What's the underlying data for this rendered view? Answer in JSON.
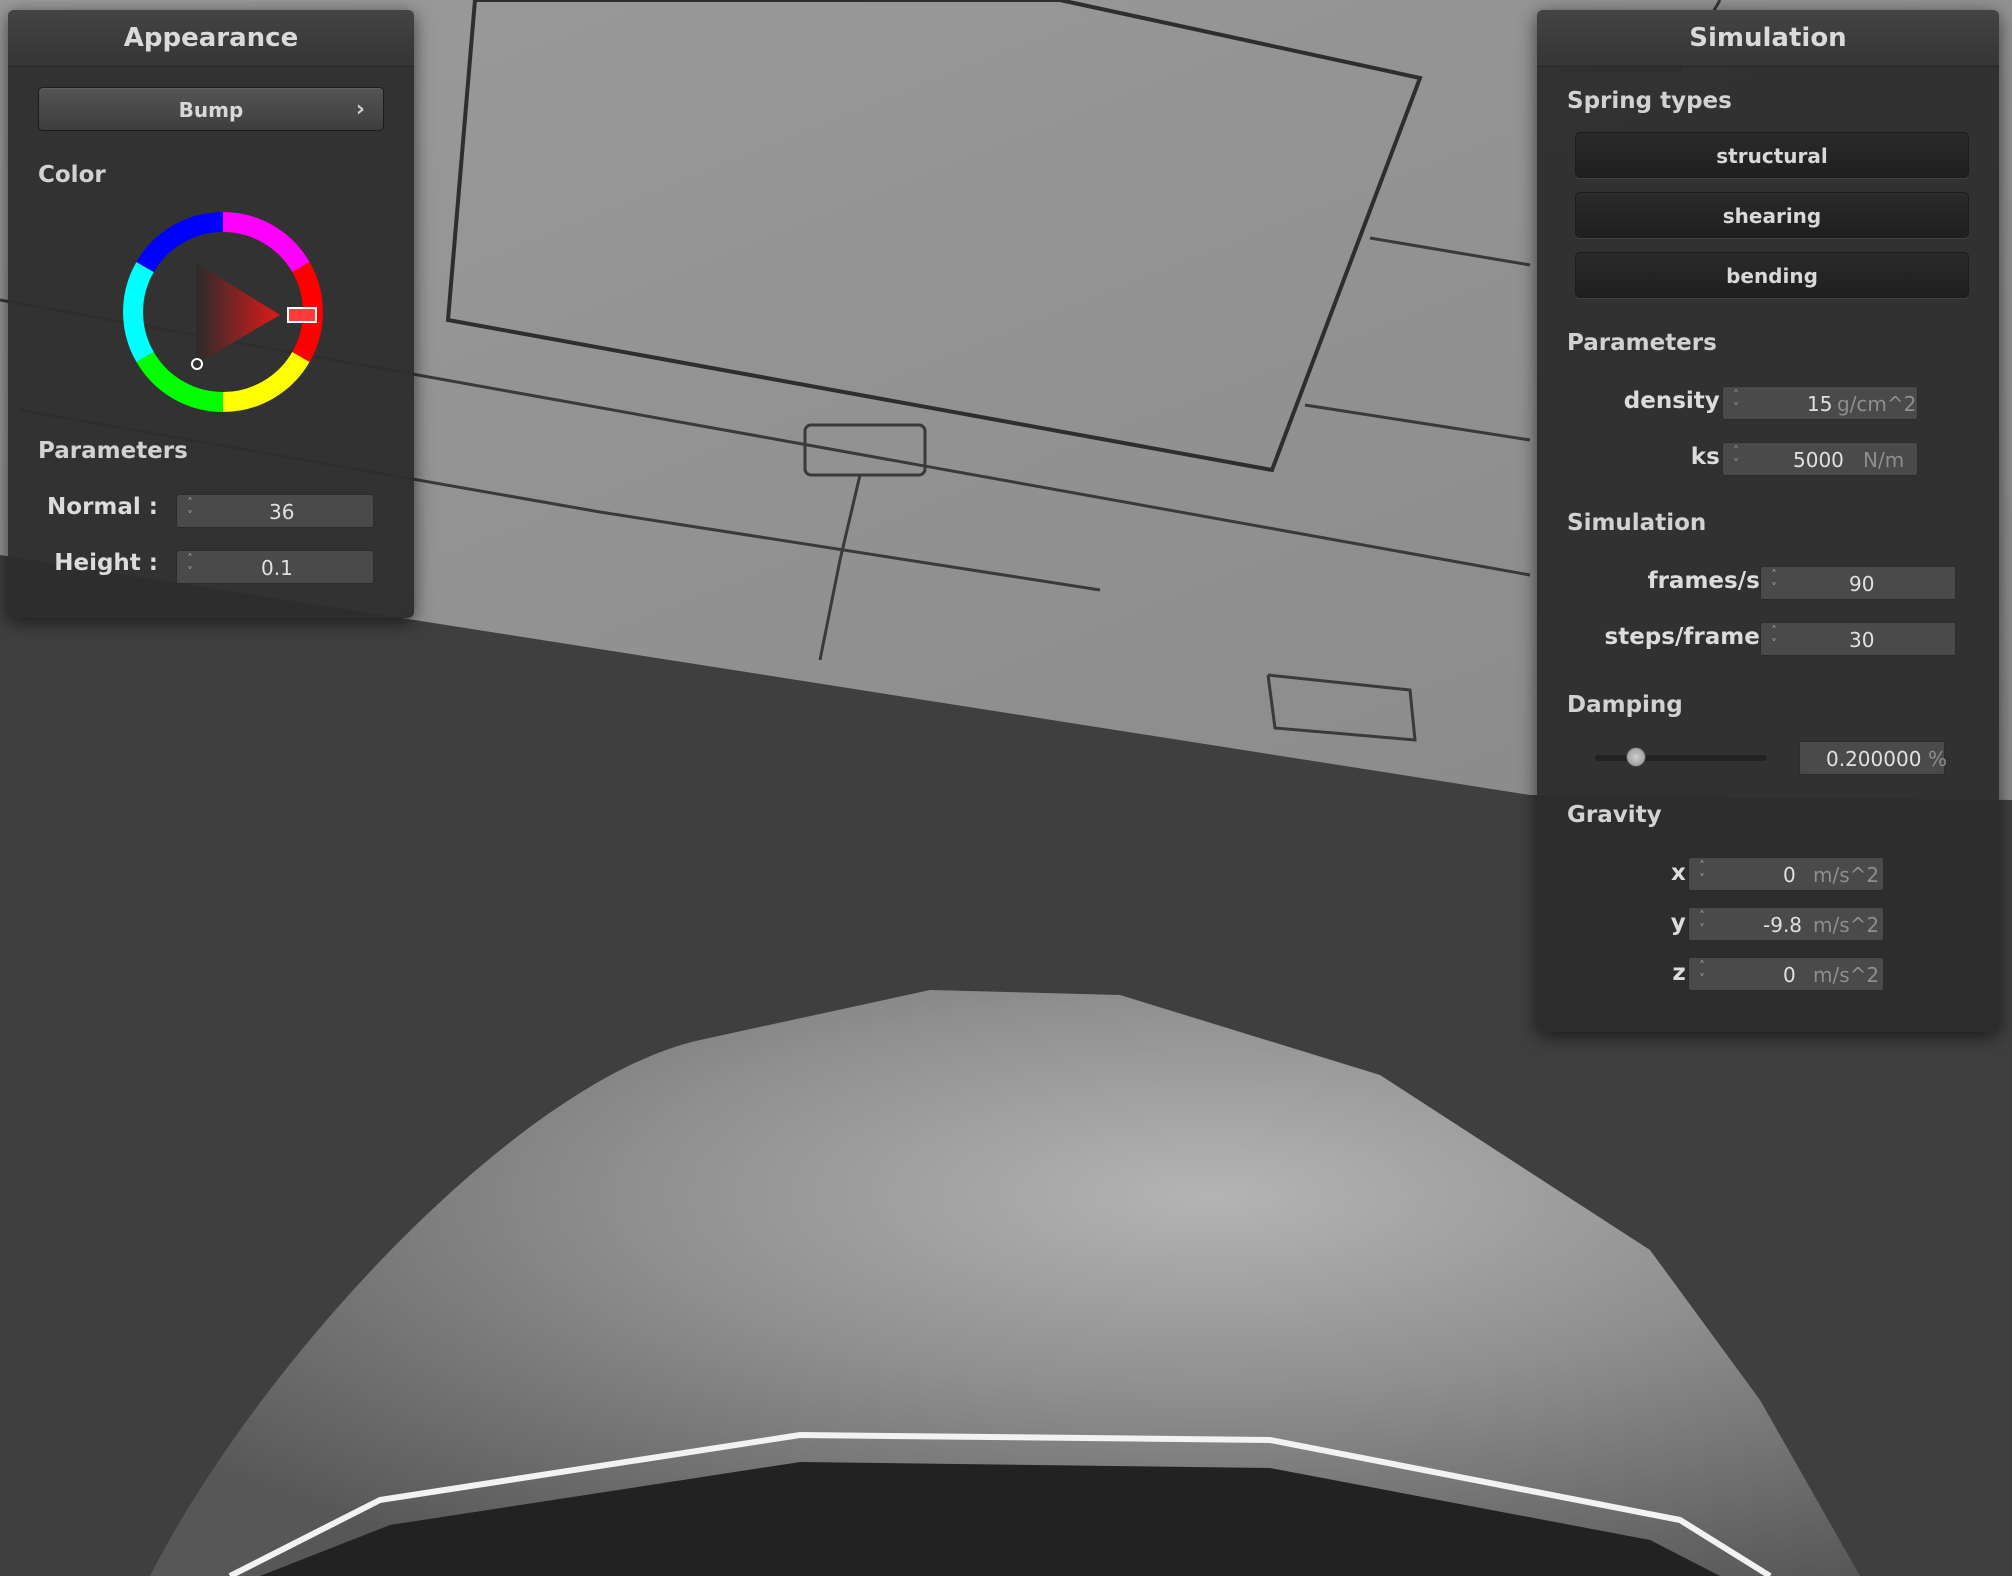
{
  "appearance": {
    "title": "Appearance",
    "mode_button": "Bump",
    "color_label": "Color",
    "color_hex": "#d7161c",
    "parameters_label": "Parameters",
    "normal": {
      "label": "Normal :",
      "value": "36"
    },
    "height": {
      "label": "Height :",
      "value": "0.1"
    }
  },
  "simulation": {
    "title": "Simulation",
    "spring_types_label": "Spring types",
    "spring_types": [
      "structural",
      "shearing",
      "bending"
    ],
    "parameters_label": "Parameters",
    "density": {
      "label": "density :",
      "value": "15",
      "unit": "g/cm^2"
    },
    "ks": {
      "label": "ks :",
      "value": "5000",
      "unit": "N/m"
    },
    "simulation_label": "Simulation",
    "fps": {
      "label": "frames/s :",
      "value": "90"
    },
    "steps": {
      "label": "steps/frame :",
      "value": "30"
    },
    "damping_label": "Damping",
    "damping": {
      "value": "0.200000",
      "unit": "%",
      "level": 0.2
    },
    "gravity_label": "Gravity",
    "gx": {
      "label": "x :",
      "value": "0",
      "unit": "m/s^2"
    },
    "gy": {
      "label": "y :",
      "value": "-9.8",
      "unit": "m/s^2"
    },
    "gz": {
      "label": "z :",
      "value": "0",
      "unit": "m/s^2"
    }
  }
}
